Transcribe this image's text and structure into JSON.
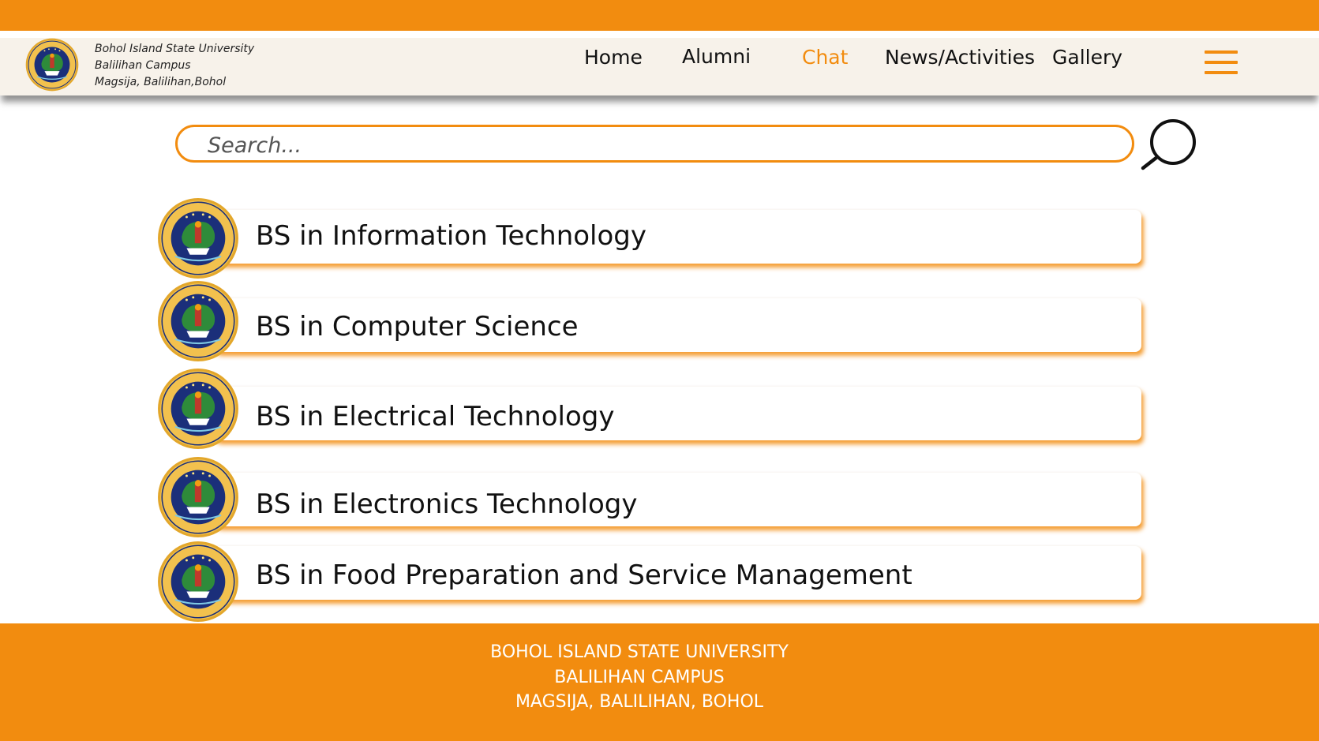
{
  "brand": {
    "line1": "Bohol Island State University",
    "line2": "Balilihan Campus",
    "line3": "Magsija, Balilihan,Bohol"
  },
  "nav": {
    "items": [
      {
        "label": "Home"
      },
      {
        "label": "Alumni"
      },
      {
        "label": "Chat",
        "active": true
      },
      {
        "label": "News/Activities"
      },
      {
        "label": "Gallery"
      }
    ]
  },
  "search": {
    "placeholder": "Search..."
  },
  "courses": [
    {
      "label": "BS in Information Technology"
    },
    {
      "label": "BS in Computer Science"
    },
    {
      "label": "BS in Electrical Technology"
    },
    {
      "label": "BS in Electronics Technology"
    },
    {
      "label": "BS in Food Preparation and Service Management"
    }
  ],
  "footer": {
    "line1": "BOHOL ISLAND STATE UNIVERSITY",
    "line2": "BALILIHAN CAMPUS",
    "line3": "MAGSIJA, BALILIHAN, BOHOL"
  },
  "colors": {
    "accent": "#f28c0f",
    "header_bg": "#f7f2ea",
    "seal_navy": "#1b2f7a",
    "seal_gold": "#e3a72b"
  },
  "icons": {
    "seal": "university-seal-icon",
    "search": "search-icon",
    "menu": "hamburger-menu-icon"
  }
}
